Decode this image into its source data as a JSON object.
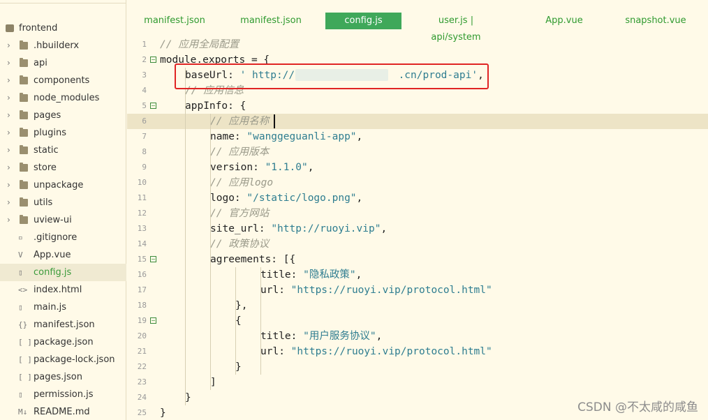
{
  "sidebar": {
    "root": "frontend",
    "items": [
      {
        "label": ".hbuilderx",
        "type": "folder"
      },
      {
        "label": "api",
        "type": "folder"
      },
      {
        "label": "components",
        "type": "folder"
      },
      {
        "label": "node_modules",
        "type": "folder"
      },
      {
        "label": "pages",
        "type": "folder"
      },
      {
        "label": "plugins",
        "type": "folder"
      },
      {
        "label": "static",
        "type": "folder"
      },
      {
        "label": "store",
        "type": "folder"
      },
      {
        "label": "unpackage",
        "type": "folder"
      },
      {
        "label": "utils",
        "type": "folder"
      },
      {
        "label": "uview-ui",
        "type": "folder"
      },
      {
        "label": ".gitignore",
        "type": "file"
      },
      {
        "label": "App.vue",
        "type": "vue"
      },
      {
        "label": "config.js",
        "type": "js",
        "selected": true
      },
      {
        "label": "index.html",
        "type": "html"
      },
      {
        "label": "main.js",
        "type": "js"
      },
      {
        "label": "manifest.json",
        "type": "json-config"
      },
      {
        "label": "package.json",
        "type": "json"
      },
      {
        "label": "package-lock.json",
        "type": "json"
      },
      {
        "label": "pages.json",
        "type": "json"
      },
      {
        "label": "permission.js",
        "type": "js"
      },
      {
        "label": "README.md",
        "type": "md"
      }
    ]
  },
  "tabs": [
    {
      "label": "manifest.json",
      "active": false
    },
    {
      "label": "manifest.json",
      "active": false
    },
    {
      "label": "config.js",
      "active": true
    },
    {
      "label": "user.js | api/system",
      "active": false
    },
    {
      "label": "App.vue",
      "active": false
    },
    {
      "label": "snapshot.vue",
      "active": false
    }
  ],
  "code": {
    "lines": [
      {
        "n": "1",
        "fold": "",
        "indent": 0,
        "parts": [
          [
            "cmt",
            "// 应用全局配置"
          ]
        ]
      },
      {
        "n": "2",
        "fold": "⊟",
        "indent": 0,
        "parts": [
          [
            "",
            "module.exports = {"
          ]
        ]
      },
      {
        "n": "3",
        "fold": "",
        "indent": 1,
        "parts": [
          [
            "",
            "baseUrl: "
          ],
          [
            "str",
            "' http://"
          ],
          [
            "str",
            "                 "
          ],
          [
            "str",
            ".cn/prod-api'"
          ],
          [
            "",
            ","
          ]
        ]
      },
      {
        "n": "4",
        "fold": "",
        "indent": 1,
        "parts": [
          [
            "cmt",
            "// 应用信息"
          ]
        ]
      },
      {
        "n": "5",
        "fold": "⊟",
        "indent": 1,
        "parts": [
          [
            "",
            "appInfo: {"
          ]
        ]
      },
      {
        "n": "6",
        "fold": "",
        "indent": 2,
        "parts": [
          [
            "cmt",
            "// 应用名称"
          ]
        ]
      },
      {
        "n": "7",
        "fold": "",
        "indent": 2,
        "parts": [
          [
            "",
            "name: "
          ],
          [
            "str",
            "\"wanggeguanli-app\""
          ],
          [
            "",
            ","
          ]
        ]
      },
      {
        "n": "8",
        "fold": "",
        "indent": 2,
        "parts": [
          [
            "cmt",
            "// 应用版本"
          ]
        ]
      },
      {
        "n": "9",
        "fold": "",
        "indent": 2,
        "parts": [
          [
            "",
            "version: "
          ],
          [
            "str",
            "\"1.1.0\""
          ],
          [
            "",
            ","
          ]
        ]
      },
      {
        "n": "10",
        "fold": "",
        "indent": 2,
        "parts": [
          [
            "cmt",
            "// 应用logo"
          ]
        ]
      },
      {
        "n": "11",
        "fold": "",
        "indent": 2,
        "parts": [
          [
            "",
            "logo: "
          ],
          [
            "str",
            "\"/static/logo.png\""
          ],
          [
            "",
            ","
          ]
        ]
      },
      {
        "n": "12",
        "fold": "",
        "indent": 2,
        "parts": [
          [
            "cmt",
            "// 官方网站"
          ]
        ]
      },
      {
        "n": "13",
        "fold": "",
        "indent": 2,
        "parts": [
          [
            "",
            "site_url: "
          ],
          [
            "str",
            "\"http://ruoyi.vip\""
          ],
          [
            "",
            ","
          ]
        ]
      },
      {
        "n": "14",
        "fold": "",
        "indent": 2,
        "parts": [
          [
            "cmt",
            "// 政策协议"
          ]
        ]
      },
      {
        "n": "15",
        "fold": "⊟",
        "indent": 2,
        "parts": [
          [
            "",
            "agreements: [{"
          ]
        ]
      },
      {
        "n": "16",
        "fold": "",
        "indent": 4,
        "parts": [
          [
            "",
            "title: "
          ],
          [
            "str",
            "\"隐私政策\""
          ],
          [
            "",
            ","
          ]
        ]
      },
      {
        "n": "17",
        "fold": "",
        "indent": 4,
        "parts": [
          [
            "",
            "url: "
          ],
          [
            "str",
            "\"https://ruoyi.vip/protocol.html\""
          ]
        ]
      },
      {
        "n": "18",
        "fold": "",
        "indent": 3,
        "parts": [
          [
            "",
            "},"
          ]
        ]
      },
      {
        "n": "19",
        "fold": "⊟",
        "indent": 3,
        "parts": [
          [
            "",
            "{"
          ]
        ]
      },
      {
        "n": "20",
        "fold": "",
        "indent": 4,
        "parts": [
          [
            "",
            "title: "
          ],
          [
            "str",
            "\"用户服务协议\""
          ],
          [
            "",
            ","
          ]
        ]
      },
      {
        "n": "21",
        "fold": "",
        "indent": 4,
        "parts": [
          [
            "",
            "url: "
          ],
          [
            "str",
            "\"https://ruoyi.vip/protocol.html\""
          ]
        ]
      },
      {
        "n": "22",
        "fold": "",
        "indent": 3,
        "parts": [
          [
            "",
            "}"
          ]
        ]
      },
      {
        "n": "23",
        "fold": "",
        "indent": 2,
        "parts": [
          [
            "",
            "]"
          ]
        ]
      },
      {
        "n": "24",
        "fold": "",
        "indent": 1,
        "parts": [
          [
            "",
            "}"
          ]
        ]
      },
      {
        "n": "25",
        "fold": "",
        "indent": 0,
        "parts": [
          [
            "",
            "}"
          ]
        ]
      }
    ],
    "highlight_line": "6"
  },
  "watermark": "CSDN @不太咸的咸鱼",
  "colors": {
    "accent": "#3fa85a",
    "string": "#2e7d90",
    "comment": "#9a9a8a",
    "annotation": "#e02424"
  }
}
